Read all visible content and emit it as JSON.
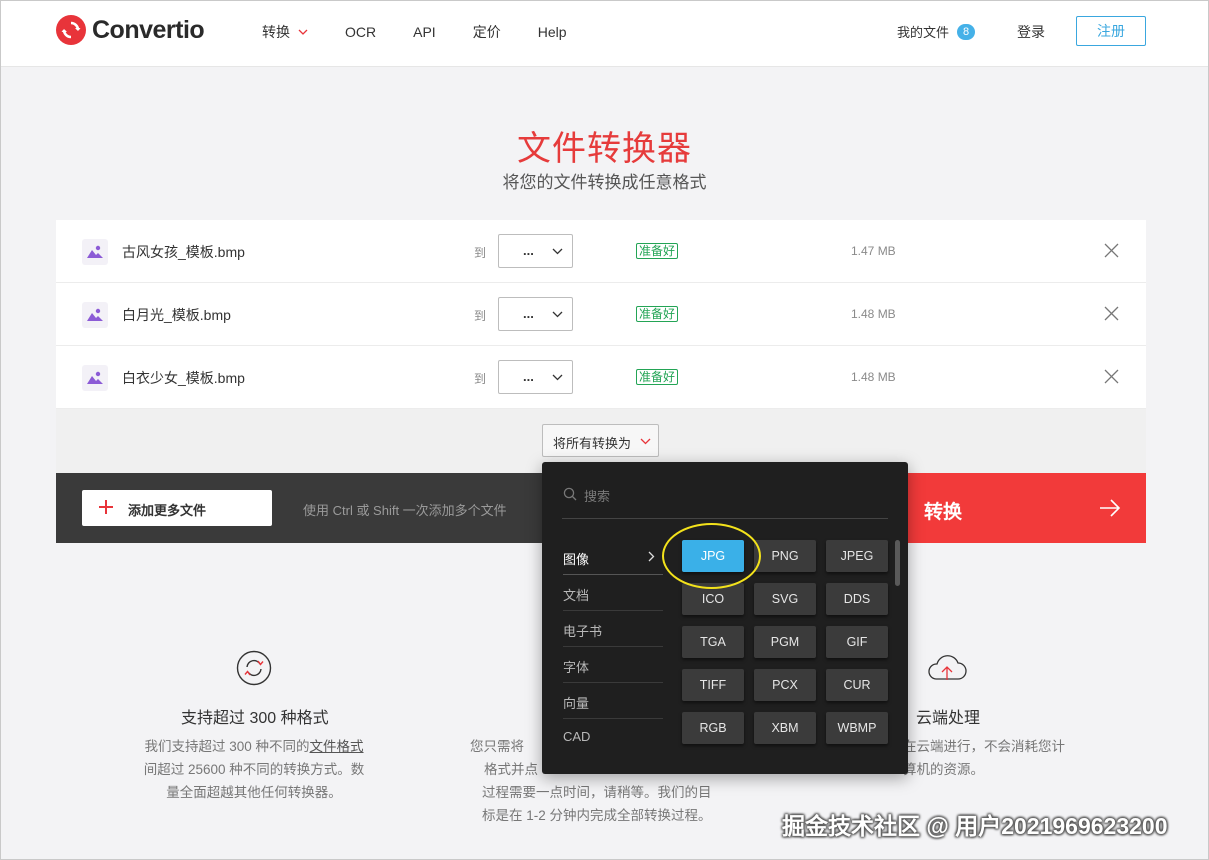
{
  "header": {
    "logo_text": "Convertio",
    "nav": [
      "转换",
      "OCR",
      "API",
      "定价",
      "Help"
    ],
    "my_files_label": "我的文件",
    "my_files_count": "8",
    "login_label": "登录",
    "register_label": "注册"
  },
  "hero": {
    "title": "文件转换器",
    "subtitle": "将您的文件转换成任意格式"
  },
  "files": [
    {
      "name": "古风女孩_模板.bmp",
      "to": "到",
      "format": "...",
      "status": "准备好",
      "size": "1.47 MB"
    },
    {
      "name": "白月光_模板.bmp",
      "to": "到",
      "format": "...",
      "status": "准备好",
      "size": "1.48 MB"
    },
    {
      "name": "白衣少女_模板.bmp",
      "to": "到",
      "format": "...",
      "status": "准备好",
      "size": "1.48 MB"
    }
  ],
  "convert_all_label": "将所有转换为",
  "action_bar": {
    "add_more_label": "添加更多文件",
    "hint": "使用 Ctrl 或 Shift 一次添加多个文件",
    "convert_label": "转换"
  },
  "dropdown": {
    "search_placeholder": "搜索",
    "categories": [
      "图像",
      "文档",
      "电子书",
      "字体",
      "向量",
      "CAD"
    ],
    "formats": [
      "JPG",
      "PNG",
      "JPEG",
      "ICO",
      "SVG",
      "DDS",
      "TGA",
      "PGM",
      "GIF",
      "TIFF",
      "PCX",
      "CUR",
      "RGB",
      "XBM",
      "WBMP"
    ],
    "selected_format": "JPG"
  },
  "features": [
    {
      "title": "支持超过 300 种格式",
      "desc_before": "我们支持超过 300 种不同的",
      "desc_link": "文件格式",
      "desc_line2": "间超过 25600 种不同的转换方式。数",
      "desc_line3": "量全面超越其他任何转换器。"
    },
    {
      "desc_line1": "您只需将",
      "desc_line2": "格式并点",
      "desc_line3": "过程需要一点时间，请稍等。我们的目",
      "desc_line4": "标是在 1-2 分钟内完成全部转换过程。"
    },
    {
      "title": "云端处理",
      "desc_line1": "在云端进行，不会消耗您计",
      "desc_line2": "算机的资源。"
    }
  ],
  "watermark": "掘金技术社区 @ 用户2021969623200",
  "colors": {
    "brand_red": "#e8343a",
    "accent_blue": "#3ab0e8",
    "ready_green": "#23a455",
    "highlight_yellow": "#f3e21b"
  }
}
